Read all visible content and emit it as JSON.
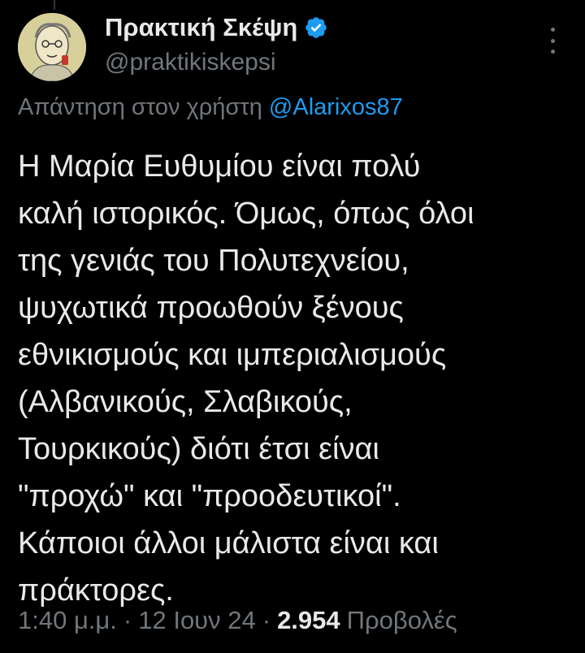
{
  "author": {
    "display_name": "Πρακτική Σκέψη",
    "handle": "@praktikiskepsi",
    "verified": true
  },
  "reply": {
    "prefix": "Απάντηση στον χρήστη",
    "mention": "@Alarixos87"
  },
  "tweet": {
    "lines": [
      "Η Μαρία Ευθυμίου είναι πολύ",
      "καλή ιστορικός. Όμως, όπως όλοι",
      "της γενιάς του Πολυτεχνείου,",
      "ψυχωτικά προωθούν ξένους",
      "εθνικισμούς και ιμπεριαλισμούς",
      "(Αλβανικούς, Σλαβικούς,",
      "Τουρκικούς) διότι έτσι είναι",
      "\"προχώ\" και \"προοδευτικοί\".",
      "Κάποιοι άλλοι μάλιστα είναι και",
      "πράκτορες."
    ]
  },
  "meta": {
    "time": "1:40 μ.μ.",
    "separator": "·",
    "date": "12 Ιουν 24",
    "views_count": "2.954",
    "views_label": "Προβολές"
  },
  "colors": {
    "background": "#000000",
    "text": "#e7e9ea",
    "muted": "#71767b",
    "accent": "#1d9bf0"
  },
  "icons": {
    "verified": "verified-badge-icon",
    "more": "more-options-icon"
  }
}
